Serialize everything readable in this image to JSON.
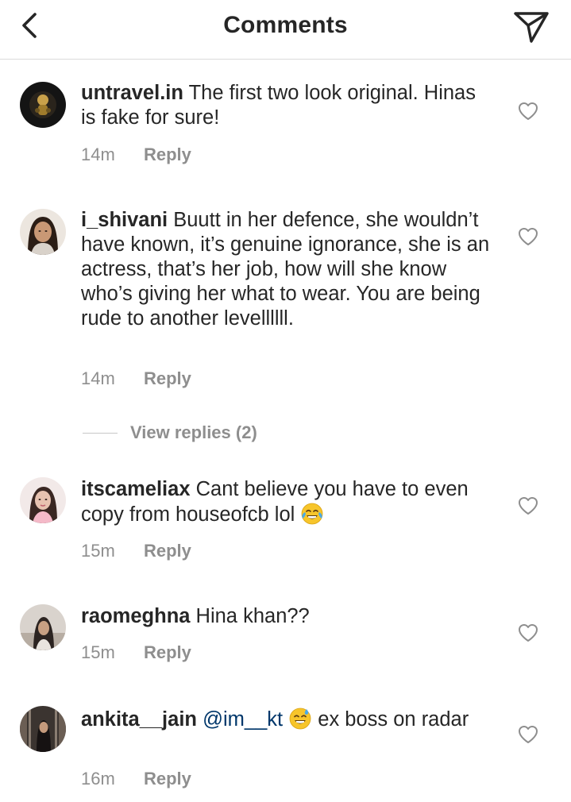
{
  "header": {
    "title": "Comments",
    "back_icon": "chevron-left-icon",
    "share_icon": "paper-plane-icon"
  },
  "comments": [
    {
      "username": "untravel.in",
      "text": "The first two look original. Hinas is fake for sure!",
      "time": "14m",
      "reply_label": "Reply"
    },
    {
      "username": "i_shivani",
      "text": "Buutt in her defence, she wouldn’t have known, it’s genuine ignorance, she is an actress, that’s her job, how will she know who’s giving her what to wear. You are being rude to another levellllll.",
      "time": "14m",
      "reply_label": "Reply"
    },
    {
      "username": "itscameliax",
      "text": "Cant believe you have to even copy from houseofcb lol",
      "emoji": "face-with-tears-of-joy",
      "time": "15m",
      "reply_label": "Reply"
    },
    {
      "username": "raomeghna",
      "text": "Hina khan??",
      "time": "15m",
      "reply_label": "Reply"
    },
    {
      "username": "ankita__jain",
      "mention": "@im__kt",
      "emoji": "grinning-face-with-sweat",
      "text": "ex boss on radar",
      "time": "16m",
      "reply_label": "Reply"
    }
  ],
  "view_replies": {
    "label": "View replies (2)"
  },
  "colors": {
    "text": "#262626",
    "secondary": "#8e8e8e",
    "mention": "#00376b",
    "divider": "#dbdbdb"
  }
}
